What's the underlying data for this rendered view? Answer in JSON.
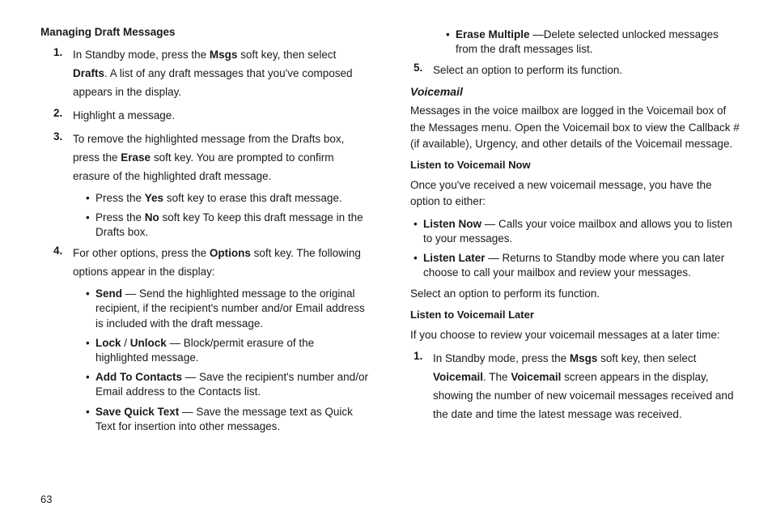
{
  "pageNumber": "63",
  "left": {
    "heading": "Managing Draft Messages",
    "steps": [
      {
        "n": "1.",
        "pre": "In Standby mode, press the ",
        "b1": "Msgs",
        "mid": " soft key, then select ",
        "b2": "Drafts",
        "post": ". A list of any draft messages that you've composed appears in the display."
      },
      {
        "n": "2.",
        "text": "Highlight a message."
      },
      {
        "n": "3.",
        "pre": "To remove the highlighted message from the Drafts box, press the ",
        "b1": "Erase",
        "post": " soft key. You are prompted to confirm erasure of the highlighted draft message."
      }
    ],
    "step3Bullets": [
      {
        "pre": "Press the ",
        "b": "Yes",
        "post": " soft key to erase this draft message."
      },
      {
        "pre": "Press the ",
        "b": "No",
        "post": " soft key To keep this draft message in the Drafts box."
      }
    ],
    "step4": {
      "n": "4.",
      "pre": "For other options, press the ",
      "b1": "Options",
      "post": " soft key. The following options appear in the display:"
    },
    "step4Bullets": [
      {
        "b": "Send",
        "post": " — Send the highlighted message to the original recipient, if the recipient's number and/or Email address is included with the draft message."
      },
      {
        "b": "Lock",
        "mid": " / ",
        "b2": "Unlock",
        "post": " — Block/permit erasure of the highlighted message."
      },
      {
        "b": "Add To Contacts",
        "post": " — Save the recipient's number and/or Email address to the Contacts list."
      },
      {
        "b": "Save Quick Text",
        "post": " — Save the message text as Quick Text for insertion into other messages."
      }
    ]
  },
  "right": {
    "contBullet": {
      "b": "Erase Multiple",
      "post": " —Delete selected unlocked messages from the draft messages list."
    },
    "step5": {
      "n": "5.",
      "text": "Select an option to perform its function."
    },
    "voicemailHeading": "Voicemail",
    "voicemailIntro": "Messages in the voice mailbox are logged in the Voicemail box of the Messages menu. Open the Voicemail box to view the Callback # (if available), Urgency, and other details of the Voicemail message.",
    "listenNowHeading": "Listen to Voicemail Now",
    "listenNowIntro": "Once you've received a new voicemail message, you have the option to either:",
    "listenBullets": [
      {
        "b": "Listen Now",
        "post": " — Calls your voice mailbox and allows you to listen to your messages."
      },
      {
        "b": "Listen Later",
        "post": " — Returns to Standby mode where you can later choose to call your mailbox and review your messages."
      }
    ],
    "listenAfter": "Select an option to perform its function.",
    "listenLaterHeading": "Listen to Voicemail Later",
    "listenLaterIntro": "If you choose to review your voicemail messages at a later time:",
    "laterStep1": {
      "n": "1.",
      "pre": "In Standby mode, press the ",
      "b1": "Msgs",
      "mid": " soft key, then select ",
      "b2": "Voicemail",
      "mid2": ". The ",
      "b3": "Voicemail",
      "post": " screen appears in the display, showing the number of new voicemail messages received and the date and time the latest message was received."
    }
  }
}
